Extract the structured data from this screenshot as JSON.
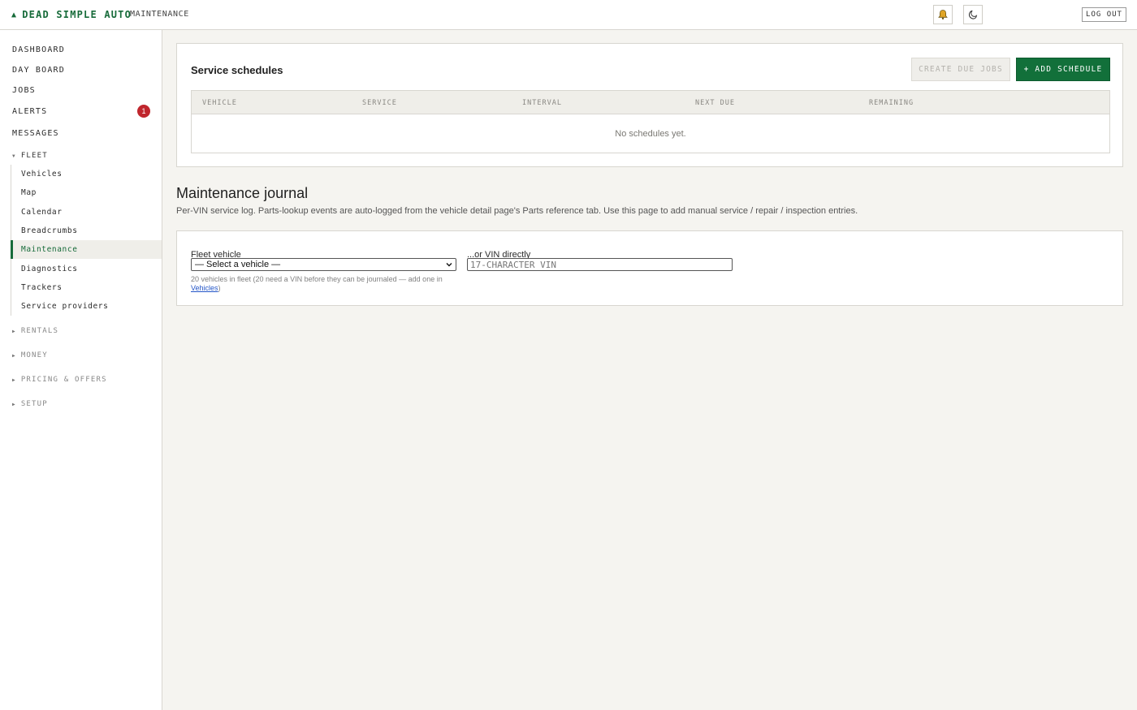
{
  "header": {
    "brand": "DEAD SIMPLE AUTO",
    "breadcrumb": "MAINTENANCE",
    "logout_label": "LOG OUT"
  },
  "sidebar": {
    "top_items": [
      {
        "label": "DASHBOARD"
      },
      {
        "label": "DAY BOARD"
      },
      {
        "label": "JOBS"
      },
      {
        "label": "ALERTS",
        "badge": "1"
      },
      {
        "label": "MESSAGES"
      }
    ],
    "fleet": {
      "label": "FLEET",
      "items": [
        {
          "label": "Vehicles"
        },
        {
          "label": "Map"
        },
        {
          "label": "Calendar"
        },
        {
          "label": "Breadcrumbs"
        },
        {
          "label": "Maintenance"
        },
        {
          "label": "Diagnostics"
        },
        {
          "label": "Trackers"
        },
        {
          "label": "Service providers"
        }
      ]
    },
    "groups": [
      {
        "label": "RENTALS"
      },
      {
        "label": "MONEY"
      },
      {
        "label": "PRICING & OFFERS"
      },
      {
        "label": "SETUP"
      }
    ]
  },
  "schedules": {
    "title": "Service schedules",
    "create_due_label": "CREATE DUE JOBS",
    "add_label": "+ ADD SCHEDULE",
    "columns": [
      "VEHICLE",
      "SERVICE",
      "INTERVAL",
      "NEXT DUE",
      "REMAINING"
    ],
    "empty_text": "No schedules yet."
  },
  "journal": {
    "title": "Maintenance journal",
    "description": "Per-VIN service log. Parts-lookup events are auto-logged from the vehicle detail page's Parts reference tab. Use this page to add manual service / repair / inspection entries.",
    "vehicle_label": "Fleet vehicle",
    "vehicle_selected": "— Select a vehicle —",
    "vin_label": "...or VIN directly",
    "vin_placeholder": "17-CHARACTER VIN",
    "help_text": "20 vehicles in fleet (20 need a VIN before they can be journaled — add one in ",
    "help_link": "Vehicles",
    "help_suffix": ")"
  },
  "colors": {
    "accent": "#12703a",
    "badge": "#c0262d",
    "background": "#f5f4f0"
  },
  "icons": [
    "logo-icon",
    "bell-icon",
    "moon-icon",
    "chevron-down-icon",
    "chevron-right-icon"
  ]
}
